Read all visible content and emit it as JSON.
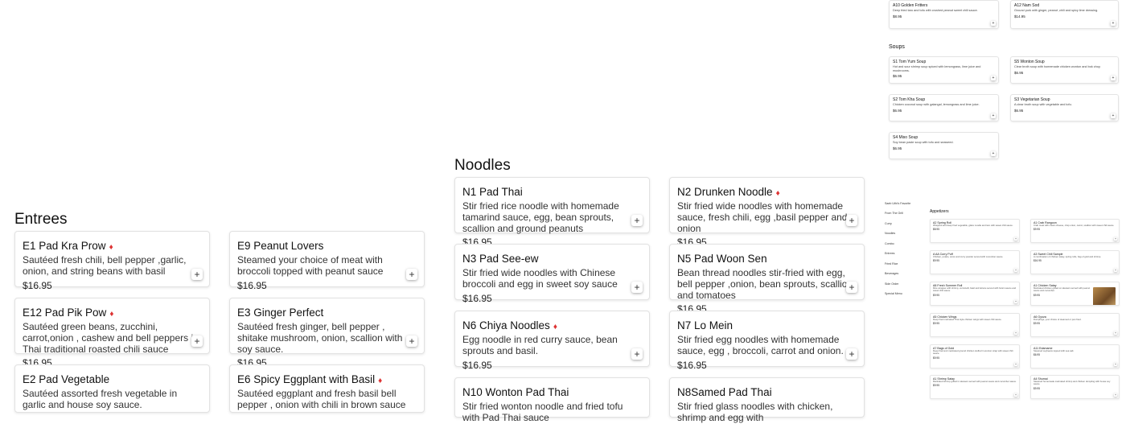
{
  "sections": {
    "entrees": "Entrees",
    "noodles": "Noodles",
    "soups": "Soups",
    "appetizers": "Appetizers"
  },
  "add_glyph": "+",
  "chili_glyph": "♦",
  "entrees": [
    {
      "name": "E1 Pad Kra Prow",
      "spicy": true,
      "desc": "Sautéed fresh chili, bell pepper ,garlic, onion, and string beans with basil",
      "price": "$16.95"
    },
    {
      "name": "E9 Peanut Lovers",
      "spicy": false,
      "desc": "Steamed your choice of meat with broccoli topped with peanut sauce",
      "price": "$16.95"
    },
    {
      "name": "E12 Pad Pik Pow",
      "spicy": true,
      "desc": "Sautéed green beans, zucchini, carrot,onion , cashew and bell peppers in Thai traditional roasted chili sauce",
      "price": "$16.95"
    },
    {
      "name": "E3 Ginger Perfect",
      "spicy": false,
      "desc": "Sautéed fresh ginger, bell pepper , shitake mushroom, onion, scallion with soy sauce.",
      "price": "$16.95"
    },
    {
      "name": "E2 Pad Vegetable",
      "spicy": false,
      "desc": "Sautéed assorted fresh vegetable in garlic and house soy sauce.",
      "price": ""
    },
    {
      "name": "E6 Spicy Eggplant with Basil",
      "spicy": true,
      "desc": "Sautéed eggplant and fresh basil bell pepper , onion with chili in brown sauce",
      "price": ""
    }
  ],
  "noodles": [
    {
      "name": "N1 Pad Thai",
      "spicy": false,
      "desc": "Stir fried rice noodle with homemade tamarind sauce, egg, bean sprouts, scallion and ground peanuts",
      "price": "$16.95"
    },
    {
      "name": "N2 Drunken Noodle",
      "spicy": true,
      "desc": "Stir fried wide noodles with homemade sauce, fresh chili, egg ,basil pepper and onion",
      "price": "$16.95"
    },
    {
      "name": "N3 Pad See-ew",
      "spicy": false,
      "desc": "Stir fried wide noodles with Chinese broccoli and egg in sweet soy sauce",
      "price": "$16.95"
    },
    {
      "name": "N5 Pad Woon Sen",
      "spicy": false,
      "desc": "Bean thread noodles stir-fried with egg, bell pepper ,onion, bean sprouts, scallion and tomatoes",
      "price": "$16.95"
    },
    {
      "name": "N6 Chiya Noodles",
      "spicy": true,
      "desc": "Egg noodle in red curry sauce, bean sprouts and basil.",
      "price": "$16.95"
    },
    {
      "name": "N7 Lo Mein",
      "spicy": false,
      "desc": "Stir fried egg noodles with homemade sauce, egg , broccoli, carrot and onion.",
      "price": "$16.95"
    },
    {
      "name": "N10 Wonton Pad Thai",
      "spicy": false,
      "desc": "Stir fried wonton noodle and fried tofu with Pad Thai sauce",
      "price": ""
    },
    {
      "name": "N8Samed Pad Thai",
      "spicy": false,
      "desc": "Stir fried glass noodles with chicken, shrimp and egg with",
      "price": ""
    }
  ],
  "top_right": [
    {
      "name": "A10 Golden Fritters",
      "desc": "Deep fried taro and tofu with crushed peanut sweet chili sauce.",
      "price": "$8.95"
    },
    {
      "name": "A12 Nam Sod",
      "desc": "Ground pork with ginger, peanut ,chili and spicy lime dressing.",
      "price": "$14.95"
    }
  ],
  "soups": [
    {
      "name": "S1 Tom Yum Soup",
      "desc": "Hot and sour shrimp soup spiced with lemongrass, lime juice and mushrooms.",
      "price": "$6.95"
    },
    {
      "name": "S5 Wonton Soup",
      "desc": "Clear broth soup with homemade chicken wonton and bok choy.",
      "price": "$6.95"
    },
    {
      "name": "S2 Tom Kha Soup",
      "desc": "Chicken coconut soup with galangal, lemongrass and lime juice.",
      "price": "$6.95"
    },
    {
      "name": "S3 Vegetarian Soup",
      "desc": "A clear broth soup with vegetable and tofu.",
      "price": "$6.95"
    },
    {
      "name": "S4 Miso Soup",
      "desc": "Soy bean paste soup with tofu and seaweed.",
      "price": "$6.95"
    }
  ],
  "nav": [
    "Saeb Uthi's Favorite",
    "From The Grill",
    "Curry",
    "Noodles",
    "Combo",
    "Entrees",
    "Fried Rice",
    "Beverages",
    "Side Order",
    "Special Menu"
  ],
  "appetizers": [
    {
      "name": "A2 Spring Roll",
      "desc": "Wrapped and deep fried vegetable, glass noodle and taro with sweet chili sauce.",
      "price": "$8.95"
    },
    {
      "name": "A1 Crab Rangoon",
      "desc": "Crab meat with cream cheese, crisp onion, carrot, scallion with sweet chili sauce.",
      "price": "$9.95"
    },
    {
      "name": "A AA Curry Puff",
      "desc": "Chicken, potato, onion and curry powder served with cucumber sauce.",
      "price": "$9.95"
    },
    {
      "name": "A3 Sweet Chili Sample",
      "desc": "A combination of chicken satay, spring rolls, bag of gold and shrimp.",
      "price": "$16.95"
    },
    {
      "name": "A8 Fresh Summer Roll",
      "desc": "Rice wrapper with shrimp, vermicelli, basil and lettuce served with hoisin sauce and sweet chili sauce.",
      "price": "$9.95"
    },
    {
      "name": "A1 Chicken Satay",
      "desc": "Marinated chicken grilled on skewers served with peanut sauce and cucumber.",
      "price": "$9.95"
    },
    {
      "name": "A5 Chicken Wings",
      "desc": "Deep fried marinated Thai style chicken wings with sweet chili sauce.",
      "price": "$9.95"
    },
    {
      "name": "A6 Gyoza",
      "desc": "Dumplings, your choice of steamed or pan fried.",
      "price": "$9.95"
    },
    {
      "name": "A7 Bags of Gold",
      "desc": "Deep fried and marinated ground chicken stuffed in wonton wrap with sweet chili sauce.",
      "price": "$9.95"
    },
    {
      "name": "A11 Edamame",
      "desc": "Steamed soybeans topped with sea salt.",
      "price": "$6.95"
    },
    {
      "name": "A1 Shrimp Satay",
      "desc": "Marinated shrimp grilled in skewers served with peanut sauce and cucumber sauce.",
      "price": "$9.95"
    },
    {
      "name": "A4 Shumai",
      "desc": "Steamed homemade marinated shrimp and chicken dumpling with house soy sauce.",
      "price": "$9.95"
    }
  ]
}
